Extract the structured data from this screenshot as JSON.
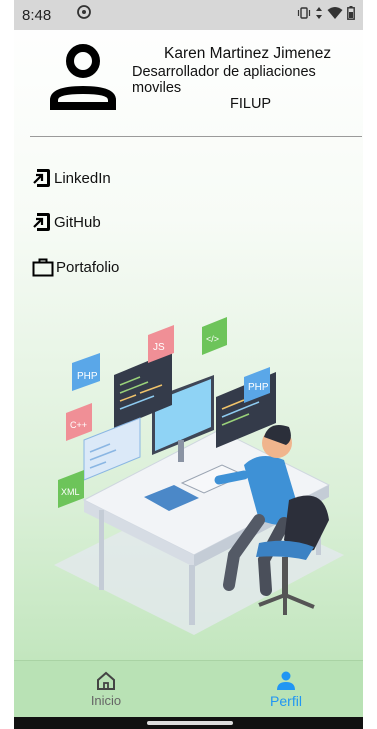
{
  "status_bar": {
    "time": "8:48"
  },
  "profile": {
    "name": "Karen Martinez Jimenez",
    "role": "Desarrollador de apliaciones moviles",
    "company": "FILUP"
  },
  "links": [
    {
      "label": "LinkedIn",
      "icon": "open-in-app-icon"
    },
    {
      "label": "GitHub",
      "icon": "open-in-app-icon"
    },
    {
      "label": "Portafolio",
      "icon": "briefcase-icon"
    }
  ],
  "illustration": {
    "tags": [
      "PHP",
      "JS",
      "</>",
      "PHP",
      "C++",
      "XML"
    ]
  },
  "bottom_nav": {
    "items": [
      {
        "label": "Inicio",
        "icon": "home-icon",
        "active": false
      },
      {
        "label": "Perfil",
        "icon": "person-icon",
        "active": true
      }
    ]
  },
  "colors": {
    "accent": "#2196f3",
    "nav_background": "#b9e2b5",
    "status_bar": "#d7d7d7"
  }
}
